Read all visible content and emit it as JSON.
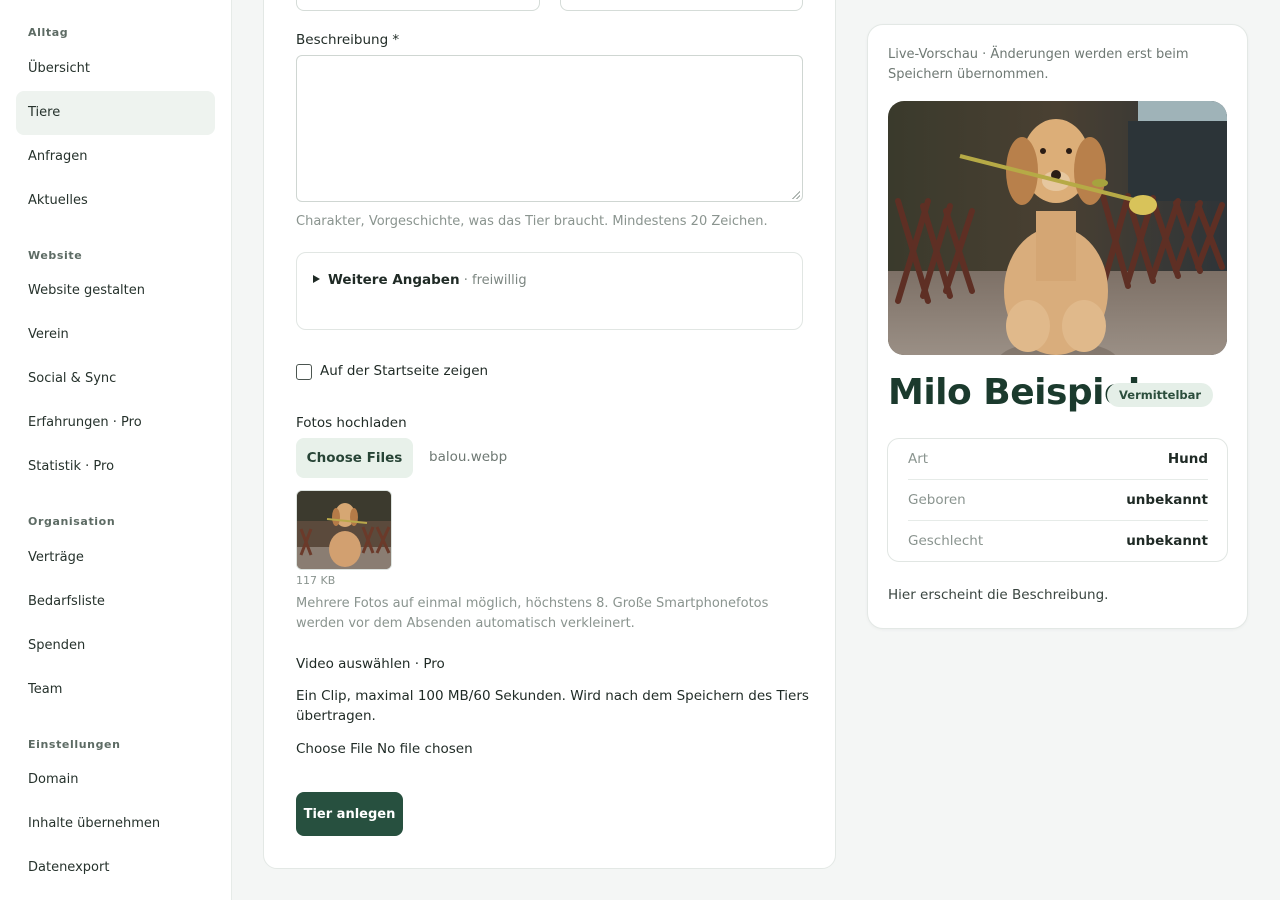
{
  "sidebar": {
    "groups": [
      {
        "label": "Alltag",
        "items": [
          "Übersicht",
          "Tiere",
          "Anfragen",
          "Aktuelles"
        ]
      },
      {
        "label": "Website",
        "items": [
          "Website gestalten",
          "Verein",
          "Social & Sync",
          "Erfahrungen · Pro",
          "Statistik · Pro"
        ]
      },
      {
        "label": "Organisation",
        "items": [
          "Verträge",
          "Bedarfsliste",
          "Spenden",
          "Team"
        ]
      },
      {
        "label": "Einstellungen",
        "items": [
          "Domain",
          "Inhalte übernehmen",
          "Datenexport"
        ]
      }
    ],
    "active_item": "Tiere"
  },
  "form": {
    "description_label": "Beschreibung *",
    "description_value": "",
    "description_hint": "Charakter, Vorgeschichte, was das Tier braucht. Mindestens 20 Zeichen.",
    "details_title": "Weitere Angaben",
    "details_sub": " · freiwillig",
    "startpage_label": "Auf der Startseite zeigen",
    "startpage_checked": false,
    "photos_label": "Fotos hochladen",
    "photos_button": "Choose Files",
    "photos_filename": "balou.webp",
    "photo_size": "117 KB",
    "photos_hint_1": "Mehrere Fotos auf einmal möglich, höchstens 8. Große Smartphonefotos",
    "photos_hint_2": "werden vor dem Absenden automatisch verkleinert.",
    "video_label": "Video auswählen · Pro",
    "video_hint_1": "Ein Clip, maximal 100 MB/60 Sekunden. Wird nach dem Speichern des Tiers",
    "video_hint_2": "übertragen.",
    "video_button": "Choose File",
    "video_status": "No file chosen",
    "submit_label": "Tier anlegen"
  },
  "preview": {
    "note_1": "Live-Vorschau · Änderungen werden erst beim",
    "note_2": "Speichern übernommen.",
    "name": "Milo Beispiel",
    "status_badge": "Vermittelbar",
    "rows": [
      {
        "key": "Art",
        "value": "Hund"
      },
      {
        "key": "Geboren",
        "value": "unbekannt"
      },
      {
        "key": "Geschlecht",
        "value": "unbekannt"
      }
    ],
    "description_placeholder": "Hier erscheint die Beschreibung."
  },
  "colors": {
    "accent": "#27503f",
    "accent_light": "#e8f1ea",
    "name_color": "#1b3a2d"
  }
}
